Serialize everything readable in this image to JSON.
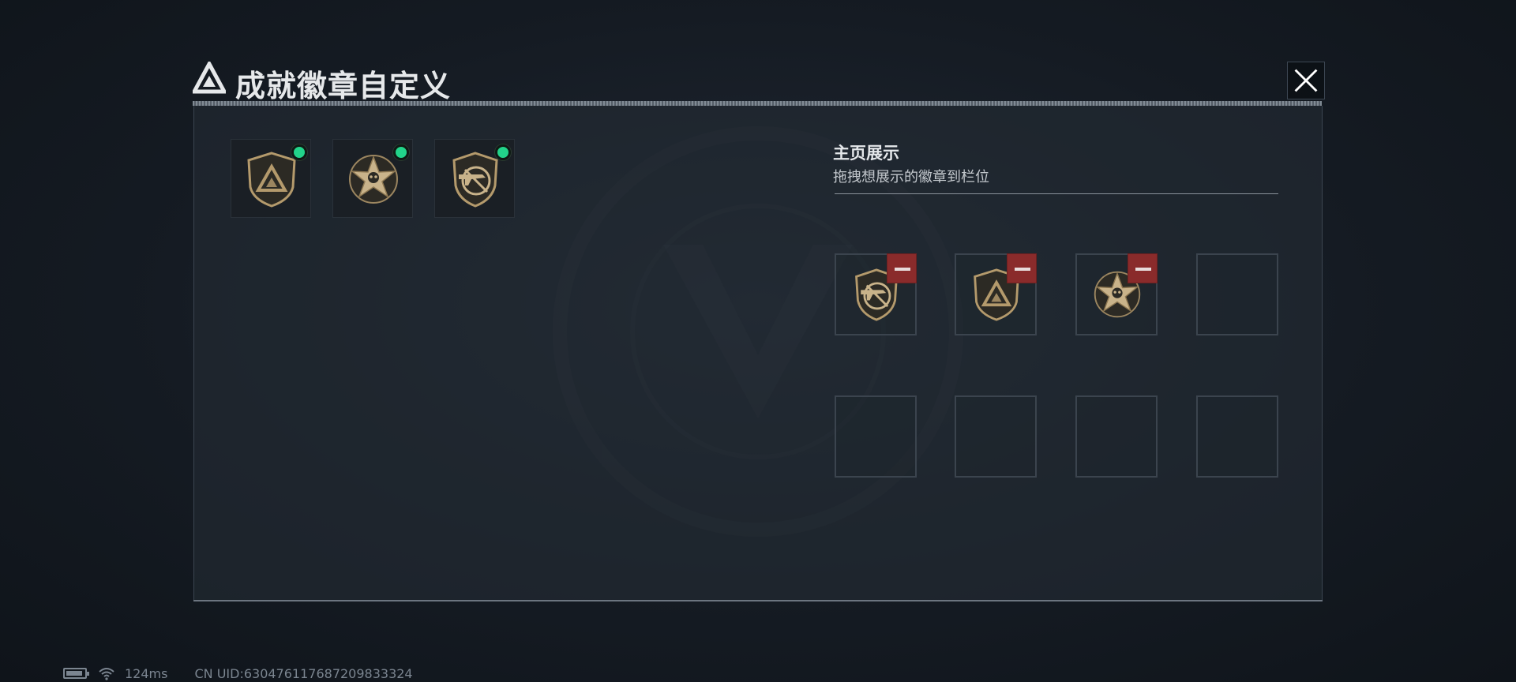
{
  "header": {
    "title": "成就徽章自定义",
    "logo_icon": "triangle-logo-icon",
    "close_icon": "close-icon"
  },
  "owned_badges": [
    {
      "name": "triangle-badge",
      "icon": "triangle-shield-badge-icon",
      "equipped": true
    },
    {
      "name": "star-badge",
      "icon": "star-skull-badge-icon",
      "equipped": true
    },
    {
      "name": "rifle-badge",
      "icon": "rifle-shield-badge-icon",
      "equipped": true
    }
  ],
  "display": {
    "title": "主页展示",
    "subtitle": "拖拽想展示的徽章到栏位",
    "slots": [
      {
        "badge": "rifle-shield-badge-icon",
        "removable": true
      },
      {
        "badge": "triangle-shield-badge-icon",
        "removable": true
      },
      {
        "badge": "star-skull-badge-icon",
        "removable": true
      },
      {
        "badge": null
      },
      {
        "badge": null
      },
      {
        "badge": null
      },
      {
        "badge": null
      },
      {
        "badge": null
      }
    ]
  },
  "status": {
    "ping": "124ms",
    "uid": "CN UID:630476117687209833324"
  },
  "colors": {
    "equipped_dot": "#22d48a",
    "remove_button": "#8a2b2b",
    "badge_gold": "#b49a6c"
  }
}
